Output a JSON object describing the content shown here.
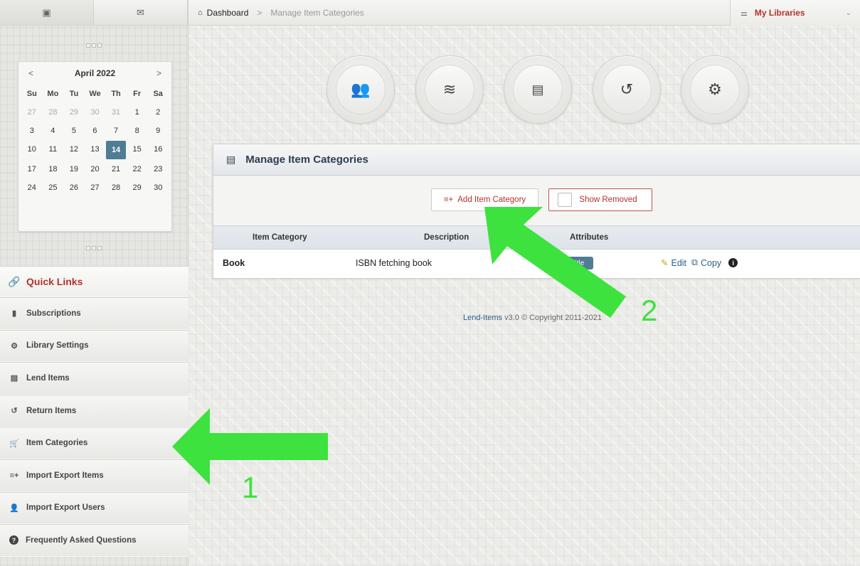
{
  "sidebar": {
    "calendar": {
      "month_label": "April 2022",
      "prev": "<",
      "next": ">",
      "weekdays": [
        "Su",
        "Mo",
        "Tu",
        "We",
        "Th",
        "Fr",
        "Sa"
      ],
      "days": [
        [
          "27",
          "28",
          "29",
          "30",
          "31",
          "1",
          "2"
        ],
        [
          "3",
          "4",
          "5",
          "6",
          "7",
          "8",
          "9"
        ],
        [
          "10",
          "11",
          "12",
          "13",
          "14",
          "15",
          "16"
        ],
        [
          "17",
          "18",
          "19",
          "20",
          "21",
          "22",
          "23"
        ],
        [
          "24",
          "25",
          "26",
          "27",
          "28",
          "29",
          "30"
        ]
      ],
      "today": "14"
    },
    "quick_links": "Quick Links",
    "items": [
      {
        "label": "Subscriptions",
        "icon": "bookmark-icon"
      },
      {
        "label": "Library Settings",
        "icon": "gear-icon"
      },
      {
        "label": "Lend Items",
        "icon": "card-icon"
      },
      {
        "label": "Return Items",
        "icon": "history-icon"
      },
      {
        "label": "Item Categories",
        "icon": "cart-icon"
      },
      {
        "label": "Import Export Items",
        "icon": "list-add-icon"
      },
      {
        "label": "Import Export Users",
        "icon": "user-add-icon"
      },
      {
        "label": "Frequently Asked Questions",
        "icon": "question-icon"
      }
    ]
  },
  "topbar": {
    "breadcrumb_home": "Dashboard",
    "breadcrumb_sep": ">",
    "breadcrumb_current": "Manage Item Categories",
    "libraries_label": "My Libraries"
  },
  "panel": {
    "title": "Manage Item Categories",
    "add_button": "Add Item Category",
    "show_removed": "Show Removed",
    "columns": [
      "Item Category",
      "Description",
      "Attributes"
    ],
    "rows": [
      {
        "category": "Book",
        "description": "ISBN fetching book",
        "attribute_pill": "Title",
        "edit": "Edit",
        "copy": "Copy"
      }
    ]
  },
  "footer": {
    "brand": "Lend-Items",
    "text": "v3.0 © Copyright 2011-2021"
  },
  "annotations": {
    "arrow1_number": "1",
    "arrow2_number": "2",
    "arrow_color": "#3ee23e"
  }
}
